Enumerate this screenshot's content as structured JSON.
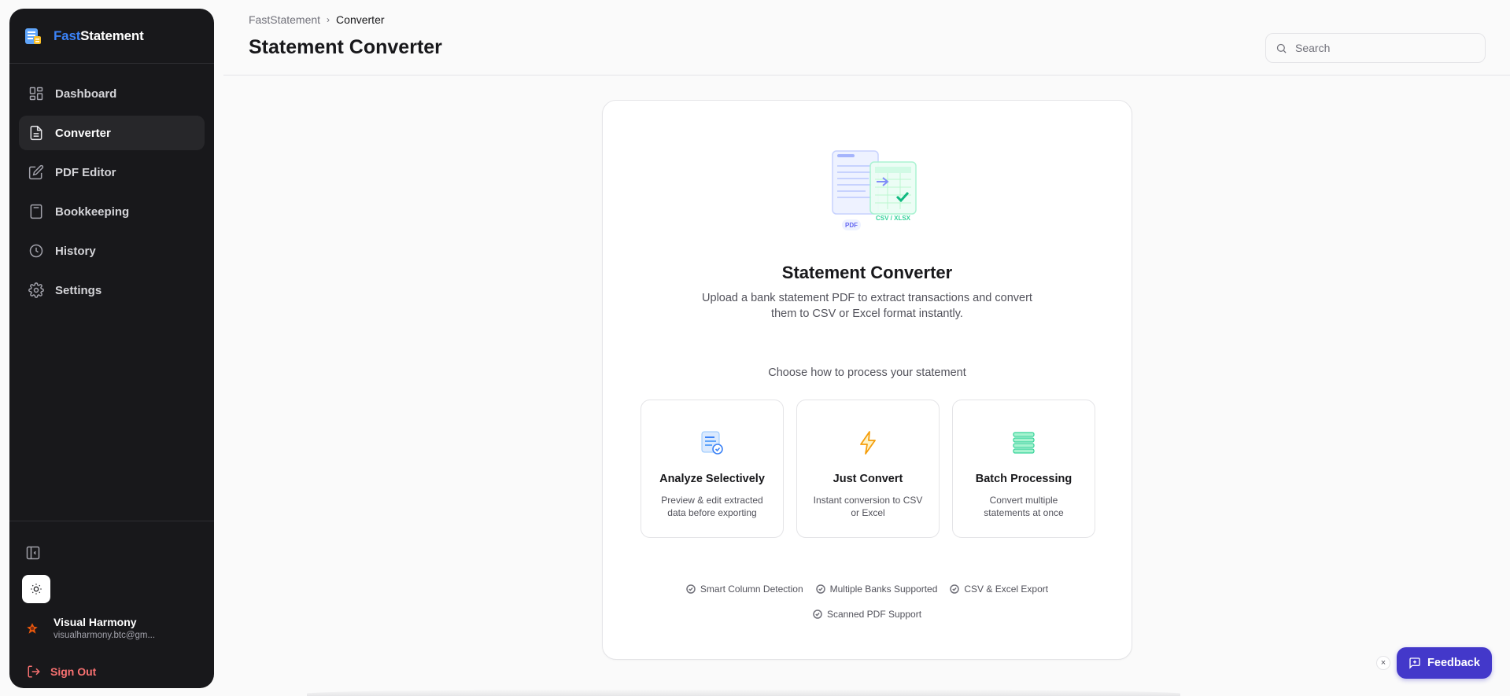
{
  "app": {
    "brand_part1": "Fast",
    "brand_part2": "Statement"
  },
  "sidebar": {
    "items": [
      {
        "label": "Dashboard",
        "icon": "dashboard-icon"
      },
      {
        "label": "Converter",
        "icon": "document-icon",
        "active": true
      },
      {
        "label": "PDF Editor",
        "icon": "edit-icon"
      },
      {
        "label": "Bookkeeping",
        "icon": "calculator-icon"
      },
      {
        "label": "History",
        "icon": "clock-icon"
      },
      {
        "label": "Settings",
        "icon": "gear-icon"
      }
    ],
    "user": {
      "name": "Visual Harmony",
      "email": "visualharmony.btc@gm..."
    },
    "signout_label": "Sign Out"
  },
  "header": {
    "breadcrumb": [
      "FastStatement",
      "Converter"
    ],
    "title": "Statement Converter",
    "search_placeholder": "Search"
  },
  "main": {
    "illustration_labels": {
      "pdf": "PDF",
      "csv": "CSV / XLSX"
    },
    "title": "Statement Converter",
    "description": "Upload a bank statement PDF to extract transactions and convert them to CSV or Excel format instantly.",
    "choose_prompt": "Choose how to process your statement",
    "options": [
      {
        "title": "Analyze Selectively",
        "description": "Preview & edit extracted data before exporting",
        "icon": "analyze-icon"
      },
      {
        "title": "Just Convert",
        "description": "Instant conversion to CSV or Excel",
        "icon": "lightning-icon"
      },
      {
        "title": "Batch Processing",
        "description": "Convert multiple statements at once",
        "icon": "stack-icon"
      }
    ],
    "features": [
      "Smart Column Detection",
      "Multiple Banks Supported",
      "CSV & Excel Export",
      "Scanned PDF Support"
    ]
  },
  "feedback": {
    "label": "Feedback",
    "close_label": "×"
  },
  "colors": {
    "sidebar_bg": "#18181b",
    "accent": "#4338ca",
    "brand_blue": "#3b82f6",
    "danger": "#f87171"
  }
}
